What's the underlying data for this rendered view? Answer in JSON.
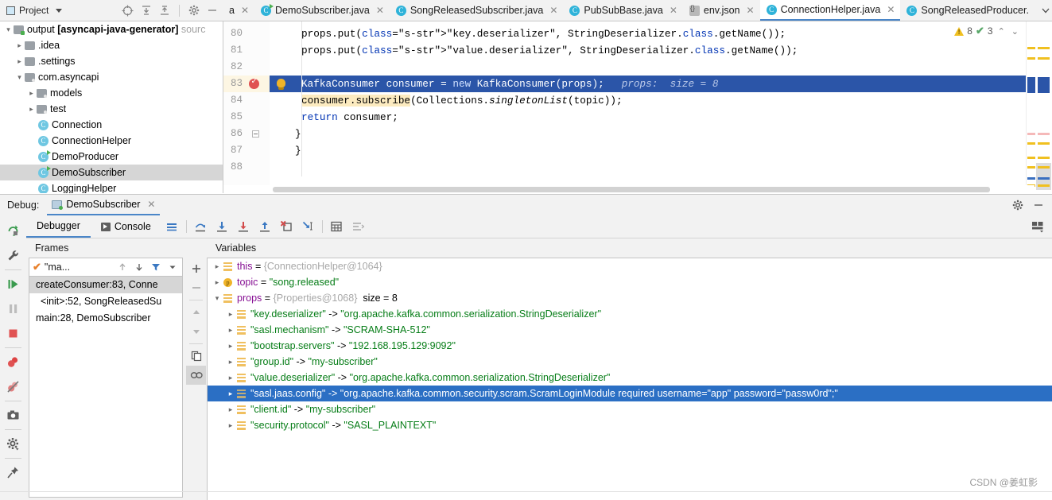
{
  "project_panel": {
    "title": "Project",
    "icons": [
      "select-opened-file-icon",
      "expand-all-icon",
      "collapse-all-icon",
      "settings-gear-icon",
      "minimize-icon"
    ],
    "tree": [
      {
        "label": "output",
        "bold_label": "[asyncapi-java-generator]",
        "suffix": "sourc",
        "indent": 0,
        "arrow": "v",
        "icon": "source-folder",
        "selected": false
      },
      {
        "label": ".idea",
        "indent": 1,
        "arrow": ">",
        "icon": "folder",
        "selected": false
      },
      {
        "label": ".settings",
        "indent": 1,
        "arrow": ">",
        "icon": "folder",
        "selected": false
      },
      {
        "label": "com.asyncapi",
        "indent": 1,
        "arrow": "v",
        "icon": "package",
        "selected": false
      },
      {
        "label": "models",
        "indent": 2,
        "arrow": ">",
        "icon": "package",
        "selected": false
      },
      {
        "label": "test",
        "indent": 2,
        "arrow": ">",
        "icon": "package",
        "selected": false
      },
      {
        "label": "Connection",
        "indent": 2,
        "arrow": "",
        "icon": "class",
        "selected": false
      },
      {
        "label": "ConnectionHelper",
        "indent": 2,
        "arrow": "",
        "icon": "class",
        "selected": false
      },
      {
        "label": "DemoProducer",
        "indent": 2,
        "arrow": "",
        "icon": "runnable-class",
        "selected": false
      },
      {
        "label": "DemoSubscriber",
        "indent": 2,
        "arrow": "",
        "icon": "runnable-class",
        "selected": true
      },
      {
        "label": "LoggingHelper",
        "indent": 2,
        "arrow": "",
        "icon": "class",
        "selected": false
      }
    ]
  },
  "editor_tabs": [
    {
      "label": "a",
      "icon": "none",
      "active": false,
      "truncated": true
    },
    {
      "label": "DemoSubscriber.java",
      "icon": "runnable-class",
      "active": false
    },
    {
      "label": "SongReleasedSubscriber.java",
      "icon": "class",
      "active": false
    },
    {
      "label": "PubSubBase.java",
      "icon": "class",
      "active": false
    },
    {
      "label": "env.json",
      "icon": "json",
      "active": false
    },
    {
      "label": "ConnectionHelper.java",
      "icon": "class",
      "active": true
    },
    {
      "label": "SongReleasedProducer.",
      "icon": "class",
      "active": false
    }
  ],
  "editor": {
    "inspection": {
      "warning_count": "8",
      "check_count": "3"
    },
    "lines": [
      {
        "num": "80",
        "text": "props.put(\"key.deserializer\", StringDeserializer.class.getName());"
      },
      {
        "num": "81",
        "text": "props.put(\"value.deserializer\", StringDeserializer.class.getName());"
      },
      {
        "num": "82",
        "text": ""
      },
      {
        "num": "83",
        "text": "KafkaConsumer consumer = new KafkaConsumer(props);",
        "inline_hint": "props:  size = 8",
        "breakpoint": true,
        "highlighted": true,
        "bulb": true
      },
      {
        "num": "84",
        "text": "consumer.subscribe(Collections.singletonList(topic));"
      },
      {
        "num": "85",
        "text": "return consumer;"
      },
      {
        "num": "86",
        "text": "}",
        "fold": true
      },
      {
        "num": "87",
        "text": "}"
      },
      {
        "num": "88",
        "text": ""
      }
    ]
  },
  "debug": {
    "label": "Debug:",
    "session_tab": "DemoSubscriber",
    "tabs": [
      {
        "label": "Debugger",
        "active": true
      },
      {
        "label": "Console",
        "active": false
      }
    ],
    "toolbar_icons": [
      "rerun-icon",
      "settings-wrench-icon",
      "resume-program-icon",
      "pause-program-icon",
      "stop-icon",
      "view-breakpoints-icon",
      "mute-breakpoints-icon",
      "camera-icon",
      "settings-gear-icon",
      "pin-icon"
    ],
    "step_icons": [
      "show-execution-point-icon",
      "step-over-icon",
      "step-into-icon",
      "force-step-into-icon",
      "step-out-icon",
      "drop-frame-icon",
      "run-to-cursor-icon",
      "evaluate-expression-icon",
      "layout-icon"
    ],
    "header_icons": [
      "settings-gear-icon",
      "minimize-icon"
    ],
    "frames": {
      "title": "Frames",
      "thread": "\"ma...",
      "thread_icons": [
        "up-arrow-icon",
        "down-arrow-icon",
        "filter-icon",
        "chevron-down-icon"
      ],
      "items": [
        {
          "label": "createConsumer:83, Conne",
          "selected": true,
          "indent": 0
        },
        {
          "label": "<init>:52, SongReleasedSu",
          "selected": false,
          "indent": 1
        },
        {
          "label": "main:28, DemoSubscriber",
          "selected": false,
          "indent": 0
        }
      ]
    },
    "variables": {
      "title": "Variables",
      "toolbar_icons": [
        "add-watch-icon",
        "remove-watch-icon",
        "move-up-icon",
        "move-down-icon",
        "copy-icon",
        "watches-icon"
      ],
      "rows": [
        {
          "indent": 0,
          "arrow": ">",
          "icon": "object",
          "name": "this",
          "op": "=",
          "ref": "{ConnectionHelper@1064}",
          "value": "",
          "selected": false
        },
        {
          "indent": 0,
          "arrow": ">",
          "icon": "primitive",
          "name": "topic",
          "op": "=",
          "ref": "",
          "value": "\"song.released\"",
          "selected": false
        },
        {
          "indent": 0,
          "arrow": "v",
          "icon": "object",
          "name": "props",
          "op": "=",
          "ref": "{Properties@1068}",
          "size": "size = 8",
          "value": "",
          "selected": false
        },
        {
          "indent": 1,
          "arrow": ">",
          "icon": "object",
          "name": "\"key.deserializer\"",
          "op": "->",
          "value": "\"org.apache.kafka.common.serialization.StringDeserializer\"",
          "selected": false
        },
        {
          "indent": 1,
          "arrow": ">",
          "icon": "object",
          "name": "\"sasl.mechanism\"",
          "op": "->",
          "value": "\"SCRAM-SHA-512\"",
          "selected": false
        },
        {
          "indent": 1,
          "arrow": ">",
          "icon": "object",
          "name": "\"bootstrap.servers\"",
          "op": "->",
          "value": "\"192.168.195.129:9092\"",
          "selected": false
        },
        {
          "indent": 1,
          "arrow": ">",
          "icon": "object",
          "name": "\"group.id\"",
          "op": "->",
          "value": "\"my-subscriber\"",
          "selected": false
        },
        {
          "indent": 1,
          "arrow": ">",
          "icon": "object",
          "name": "\"value.deserializer\"",
          "op": "->",
          "value": "\"org.apache.kafka.common.serialization.StringDeserializer\"",
          "selected": false
        },
        {
          "indent": 1,
          "arrow": ">",
          "icon": "object",
          "name": "\"sasl.jaas.config\"",
          "op": "->",
          "value": "\"org.apache.kafka.common.security.scram.ScramLoginModule required username=\"app\" password=\"passw0rd\";\"",
          "selected": true
        },
        {
          "indent": 1,
          "arrow": ">",
          "icon": "object",
          "name": "\"client.id\"",
          "op": "->",
          "value": "\"my-subscriber\"",
          "selected": false
        },
        {
          "indent": 1,
          "arrow": ">",
          "icon": "object",
          "name": "\"security.protocol\"",
          "op": "->",
          "value": "\"SASL_PLAINTEXT\"",
          "selected": false
        }
      ]
    }
  },
  "watermark": "CSDN @姜虹影",
  "colors": {
    "selection_blue": "#2b55a8",
    "var_selection_blue": "#2b6fc4",
    "string_green": "#067d17",
    "keyword_blue": "#0033b3",
    "breakpoint_red": "#e05252",
    "accent_tab": "#4a86c8"
  }
}
